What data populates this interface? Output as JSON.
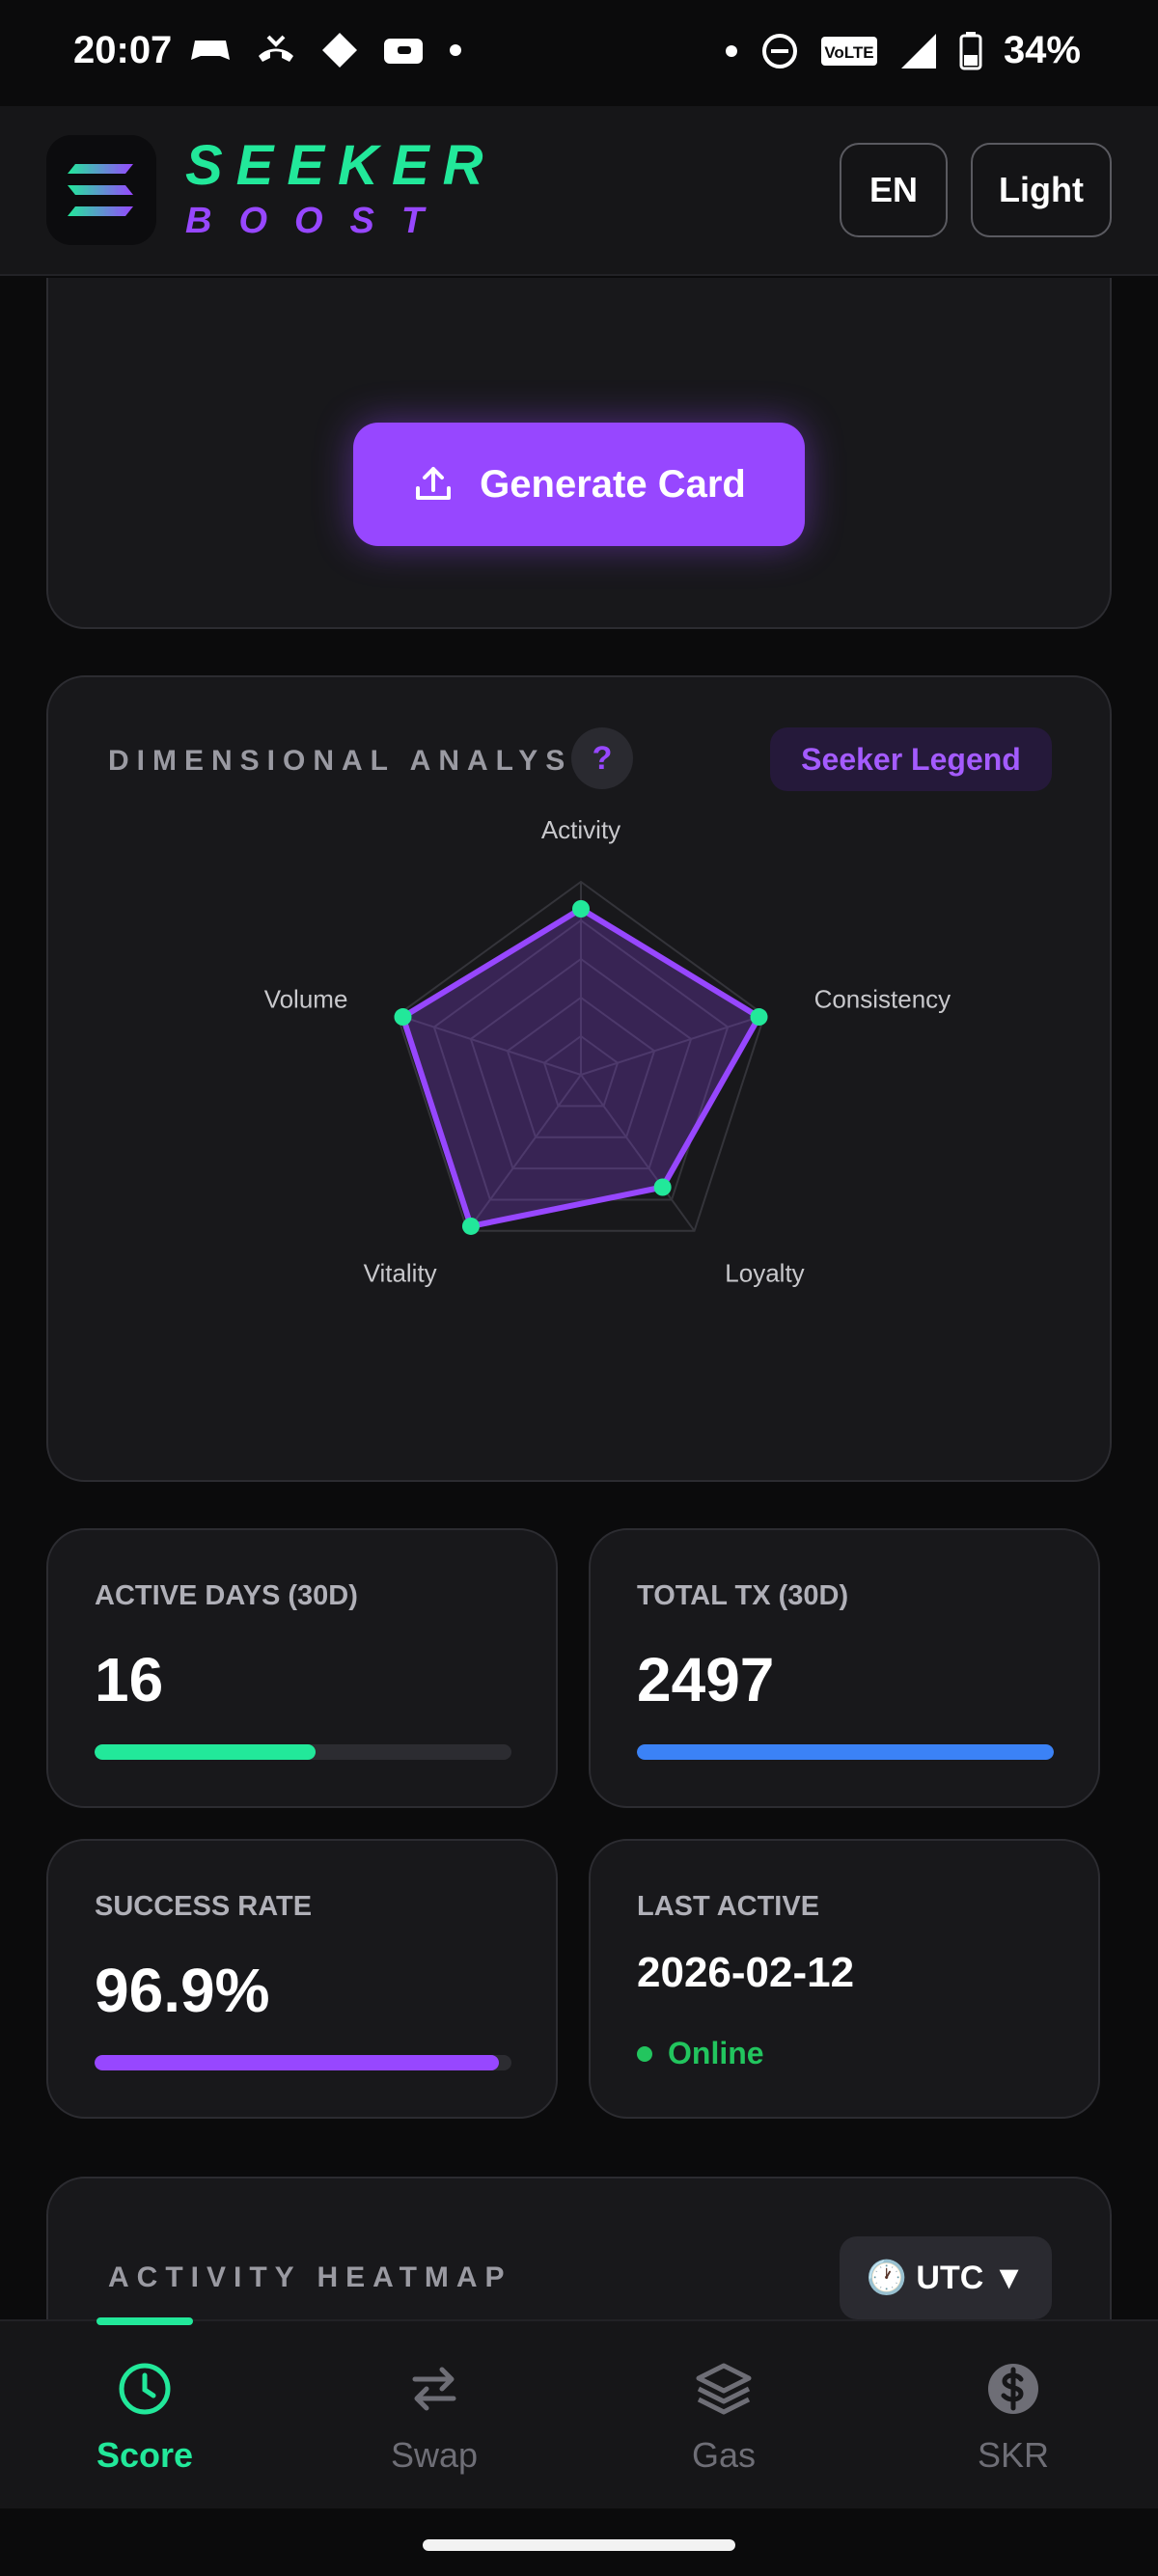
{
  "status_bar": {
    "time": "20:07",
    "battery_percent": "34%",
    "network_label": "VoLTE"
  },
  "header": {
    "logo_title": "SEEKER",
    "logo_subtitle": "BOOST",
    "language_button": "EN",
    "theme_button": "Light"
  },
  "score_card": {
    "generate_button": "Generate Card"
  },
  "dimensional_analysis": {
    "title": "DIMENSIONAL ANALYSIS",
    "help_label": "?",
    "badge": "Seeker Legend",
    "axes": [
      "Activity",
      "Consistency",
      "Loyalty",
      "Vitality",
      "Volume"
    ],
    "values": [
      0.86,
      0.97,
      0.72,
      0.97,
      0.97
    ],
    "fill_color": "#9747ff",
    "point_color": "#22e89a"
  },
  "stats": {
    "active_days": {
      "label": "ACTIVE DAYS (30D)",
      "value": "16",
      "progress": 0.53,
      "color": "#22e89a"
    },
    "total_tx": {
      "label": "TOTAL TX (30D)",
      "value": "2497",
      "progress": 1.0,
      "color": "#3b82f6"
    },
    "success_rate": {
      "label": "SUCCESS RATE",
      "value": "96.9%",
      "progress": 0.969,
      "color": "#9747ff"
    },
    "last_active": {
      "label": "LAST ACTIVE",
      "value": "2026-02-12",
      "status": "Online"
    }
  },
  "heatmap": {
    "title": "ACTIVITY HEATMAP",
    "timezone_button": "🕐 UTC ▼"
  },
  "nav": {
    "items": [
      {
        "label": "Score",
        "icon": "clock-icon",
        "active": true
      },
      {
        "label": "Swap",
        "icon": "swap-arrows-icon",
        "active": false
      },
      {
        "label": "Gas",
        "icon": "layers-icon",
        "active": false
      },
      {
        "label": "SKR",
        "icon": "dollar-coin-icon",
        "active": false
      }
    ]
  }
}
